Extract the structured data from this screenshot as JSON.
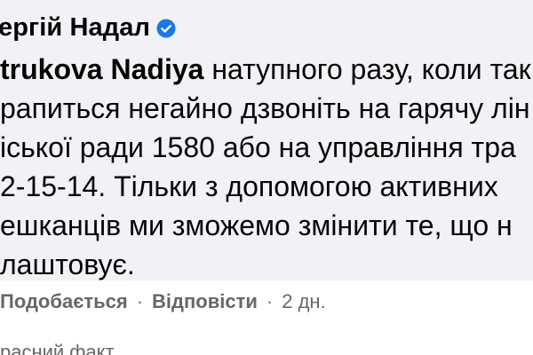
{
  "comment": {
    "author": "ергій Надал",
    "verified_icon": "verified-badge-icon",
    "mention": "trukova Nadiya",
    "lines": [
      " натупного разу, коли так",
      "рапиться негайно дзвоніть на гарячу лін",
      "іської ради 1580 або на управління тра",
      "2-15-14. Тільки з допомогою активних",
      "ешканців ми зможемо змінити те, що н",
      "лаштовує."
    ]
  },
  "actions": {
    "like": "Подобається",
    "separator": "·",
    "reply": "Відповісти",
    "time": "2 дн."
  },
  "next_reply": {
    "text": "расний факт"
  },
  "colors": {
    "bubble": "#f0f2f5",
    "text": "#050505",
    "secondary": "#65676b",
    "verified": "#1877f2"
  }
}
